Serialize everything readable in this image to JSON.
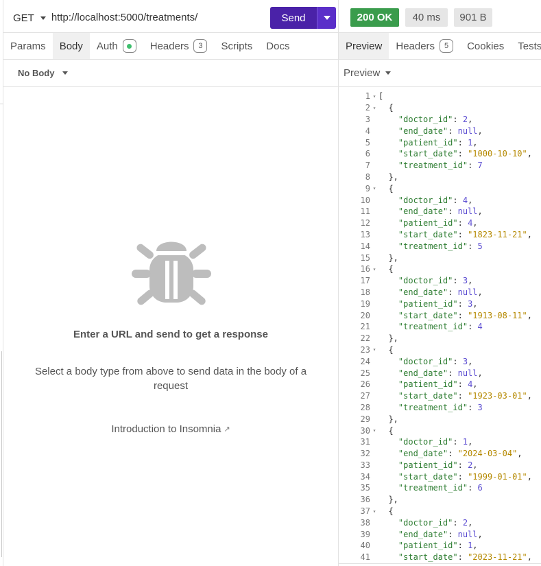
{
  "request": {
    "method": "GET",
    "url": "http://localhost:5000/treatments/",
    "send_label": "Send"
  },
  "request_tabs": [
    {
      "label": "Params"
    },
    {
      "label": "Body",
      "active": true
    },
    {
      "label": "Auth",
      "indicator": "green-dot"
    },
    {
      "label": "Headers",
      "badge": "3"
    },
    {
      "label": "Scripts"
    },
    {
      "label": "Docs"
    }
  ],
  "body_type": "No Body",
  "empty_state": {
    "icon": "bug-icon",
    "title": "Enter a URL and send to get a response",
    "description": "Select a body type from above to send data in the body of a request",
    "link": "Introduction to Insomnia"
  },
  "response": {
    "status": "200 OK",
    "time": "40 ms",
    "size": "901 B",
    "status_color": "#3a9c4c"
  },
  "response_tabs": [
    {
      "label": "Preview",
      "active": true
    },
    {
      "label": "Headers",
      "badge": "5"
    },
    {
      "label": "Cookies"
    },
    {
      "label": "Tests"
    }
  ],
  "preview_mode": "Preview",
  "code_lines": [
    {
      "n": "1",
      "fold": true,
      "text": "["
    },
    {
      "n": "2",
      "fold": true,
      "text": "  {"
    },
    {
      "n": "3",
      "text": "    \"doctor_id\": 2,"
    },
    {
      "n": "4",
      "text": "    \"end_date\": null,"
    },
    {
      "n": "5",
      "text": "    \"patient_id\": 1,"
    },
    {
      "n": "6",
      "text": "    \"start_date\": \"1000-10-10\","
    },
    {
      "n": "7",
      "text": "    \"treatment_id\": 7"
    },
    {
      "n": "8",
      "text": "  },"
    },
    {
      "n": "9",
      "fold": true,
      "text": "  {"
    },
    {
      "n": "10",
      "text": "    \"doctor_id\": 4,"
    },
    {
      "n": "11",
      "text": "    \"end_date\": null,"
    },
    {
      "n": "12",
      "text": "    \"patient_id\": 4,"
    },
    {
      "n": "13",
      "text": "    \"start_date\": \"1823-11-21\","
    },
    {
      "n": "14",
      "text": "    \"treatment_id\": 5"
    },
    {
      "n": "15",
      "text": "  },"
    },
    {
      "n": "16",
      "fold": true,
      "text": "  {"
    },
    {
      "n": "17",
      "text": "    \"doctor_id\": 3,"
    },
    {
      "n": "18",
      "text": "    \"end_date\": null,"
    },
    {
      "n": "19",
      "text": "    \"patient_id\": 3,"
    },
    {
      "n": "20",
      "text": "    \"start_date\": \"1913-08-11\","
    },
    {
      "n": "21",
      "text": "    \"treatment_id\": 4"
    },
    {
      "n": "22",
      "text": "  },"
    },
    {
      "n": "23",
      "fold": true,
      "text": "  {"
    },
    {
      "n": "24",
      "text": "    \"doctor_id\": 3,"
    },
    {
      "n": "25",
      "text": "    \"end_date\": null,"
    },
    {
      "n": "26",
      "text": "    \"patient_id\": 4,"
    },
    {
      "n": "27",
      "text": "    \"start_date\": \"1923-03-01\","
    },
    {
      "n": "28",
      "text": "    \"treatment_id\": 3"
    },
    {
      "n": "29",
      "text": "  },"
    },
    {
      "n": "30",
      "fold": true,
      "text": "  {"
    },
    {
      "n": "31",
      "text": "    \"doctor_id\": 1,"
    },
    {
      "n": "32",
      "text": "    \"end_date\": \"2024-03-04\","
    },
    {
      "n": "33",
      "text": "    \"patient_id\": 2,"
    },
    {
      "n": "34",
      "text": "    \"start_date\": \"1999-01-01\","
    },
    {
      "n": "35",
      "text": "    \"treatment_id\": 6"
    },
    {
      "n": "36",
      "text": "  },"
    },
    {
      "n": "37",
      "fold": true,
      "text": "  {"
    },
    {
      "n": "38",
      "text": "    \"doctor_id\": 2,"
    },
    {
      "n": "39",
      "text": "    \"end_date\": null,"
    },
    {
      "n": "40",
      "text": "    \"patient_id\": 1,"
    },
    {
      "n": "41",
      "text": "    \"start_date\": \"2023-11-21\","
    }
  ],
  "colors": {
    "accent": "#4a22a8",
    "json_key": "#2e7d32",
    "json_string": "#b58900",
    "json_number": "#5a4bd1"
  }
}
